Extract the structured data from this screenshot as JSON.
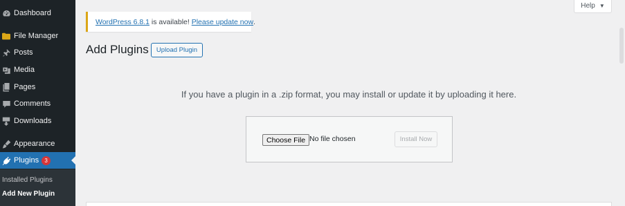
{
  "sidebar": {
    "items": [
      {
        "label": "Dashboard",
        "icon": "dashboard-icon"
      },
      {
        "label": "File Manager",
        "icon": "folder-icon"
      },
      {
        "label": "Posts",
        "icon": "pin-icon"
      },
      {
        "label": "Media",
        "icon": "media-icon"
      },
      {
        "label": "Pages",
        "icon": "pages-icon"
      },
      {
        "label": "Comments",
        "icon": "comment-icon"
      },
      {
        "label": "Downloads",
        "icon": "download-icon"
      },
      {
        "label": "Appearance",
        "icon": "brush-icon"
      },
      {
        "label": "Plugins",
        "icon": "plugin-icon",
        "badge": "3"
      }
    ],
    "submenu": [
      {
        "label": "Installed Plugins"
      },
      {
        "label": "Add New Plugin"
      }
    ]
  },
  "help": {
    "label": "Help",
    "caret": "▼"
  },
  "notice": {
    "version_link": "WordPress 6.8.1",
    "middle_text": " is available! ",
    "update_link": "Please update now",
    "end_text": "."
  },
  "page": {
    "title": "Add Plugins",
    "upload_button": "Upload Plugin"
  },
  "upload": {
    "help_text": "If you have a plugin in a .zip format, you may install or update it by uploading it here.",
    "choose_file": "Choose File",
    "file_status": "No file chosen",
    "install_button": "Install Now"
  },
  "colors": {
    "sidebar_bg": "#1d2327",
    "accent": "#2271b1",
    "badge": "#d63638",
    "notice_border": "#dba617"
  }
}
